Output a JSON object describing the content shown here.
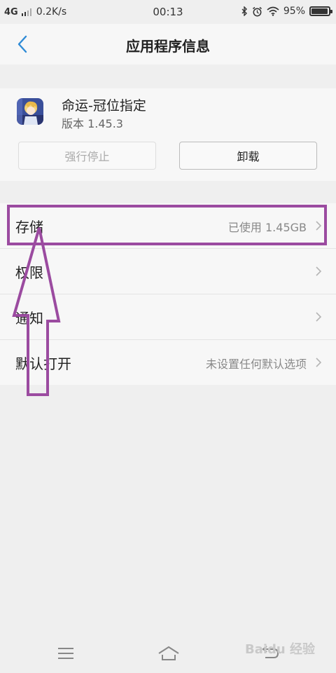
{
  "status_bar": {
    "network": "4G",
    "speed": "0.2K/s",
    "time": "00:13",
    "battery": "95%",
    "battery_level": 0.95,
    "icons": [
      "bluetooth-icon",
      "alarm-icon",
      "wifi-icon",
      "battery-icon"
    ]
  },
  "header": {
    "title": "应用程序信息",
    "back_icon": "chevron-left-icon"
  },
  "app": {
    "name": "命运-冠位指定",
    "version": "版本 1.45.3",
    "force_stop_label": "强行停止",
    "force_stop_enabled": false,
    "uninstall_label": "卸载"
  },
  "settings": [
    {
      "label": "存储",
      "value": "已使用 1.45GB"
    },
    {
      "label": "权限",
      "value": ""
    },
    {
      "label": "通知",
      "value": ""
    },
    {
      "label": "默认打开",
      "value": "未设置任何默认选项"
    }
  ],
  "annotation": {
    "highlight_color": "#9b4ba0",
    "highlighted_item": "存储"
  },
  "navbar": {
    "icons": [
      "menu-icon",
      "home-icon",
      "back-icon"
    ]
  },
  "watermark": "Baidu 经验",
  "colors": {
    "accent": "#2f8bd6",
    "background": "#efefef",
    "card": "#f7f7f7"
  }
}
